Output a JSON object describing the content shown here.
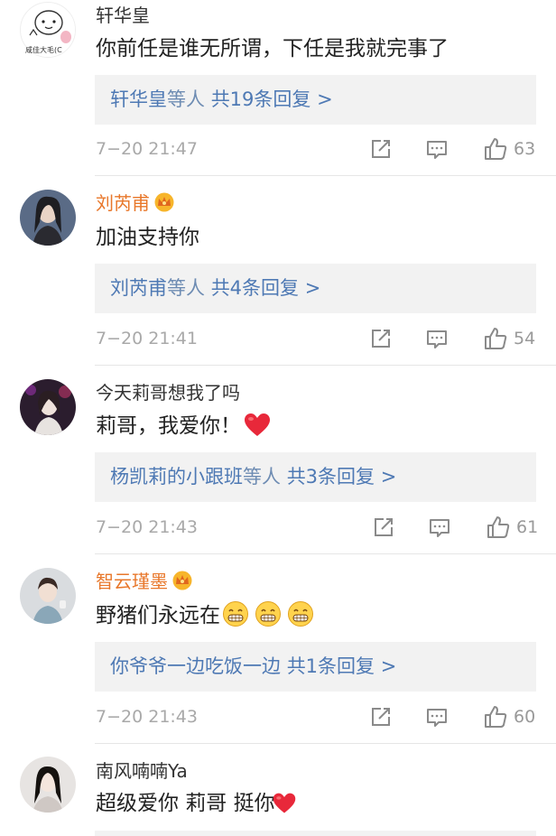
{
  "comments": [
    {
      "user": "轩华皇",
      "vip": false,
      "avatar_caption": "咸佳大毛(C",
      "text": "你前任是谁无所谓，下任是我就完事了",
      "reply_users": "轩华皇",
      "reply_mid": "等人",
      "reply_count": "共19条回复 >",
      "time": "7−20 21:47",
      "likes": "63"
    },
    {
      "user": "刘芮甫",
      "vip": true,
      "text": "加油支持你",
      "reply_users": "刘芮甫",
      "reply_mid": "等人",
      "reply_count": "共4条回复 >",
      "time": "7−20 21:41",
      "likes": "54"
    },
    {
      "user": "今天莉哥想我了吗",
      "vip": false,
      "text": "莉哥，我爱你！",
      "reply_users": "杨凯莉的小跟班",
      "reply_mid": "等人",
      "reply_count": "共3条回复 >",
      "time": "7−20 21:43",
      "likes": "61"
    },
    {
      "user": "智云瑾墨",
      "vip": true,
      "text": "野猪们永远在",
      "reply_users": "你爷爷一边吃饭一边",
      "reply_mid": "",
      "reply_count": "共1条回复 >",
      "time": "7−20 21:43",
      "likes": "60"
    },
    {
      "user": "南风喃喃Ya",
      "vip": false,
      "text": "超级爱你 莉哥 挺你"
    }
  ],
  "colors": {
    "vip_name": "#e8772a",
    "reply_link": "#4e79b4",
    "reply_bg": "#f2f2f2",
    "meta_gray": "#a9a9a9",
    "heart": "#e8283a"
  },
  "icons": [
    "share-icon",
    "comment-icon",
    "like-icon",
    "crown-icon",
    "heart-emoji",
    "grin-emoji"
  ]
}
